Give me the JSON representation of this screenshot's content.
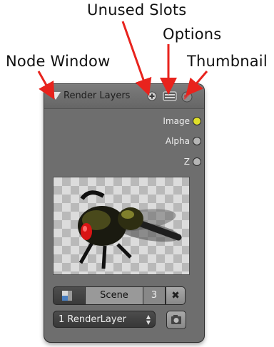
{
  "callouts": {
    "unused_slots": "Unused Slots",
    "options": "Options",
    "node_window": "Node Window",
    "thumbnail": "Thumbnail"
  },
  "node": {
    "title": "Render Layers",
    "outputs": [
      {
        "label": "Image",
        "socket_color": "#e0e02a"
      },
      {
        "label": "Alpha",
        "socket_color": "#b5b5b5"
      },
      {
        "label": "Z",
        "socket_color": "#b5b5b5"
      }
    ],
    "scene": {
      "name": "Scene",
      "users": "3",
      "icon": "scene-datablock-icon",
      "clear_icon": "x-icon"
    },
    "layer_select": {
      "value": "1 RenderLayer",
      "icon": "updown-arrows-icon"
    },
    "render_button_icon": "camera-icon"
  },
  "colors": {
    "arrow": "#e8231d",
    "node_bg": "#6e6e6e",
    "image_socket": "#e0e02a"
  }
}
